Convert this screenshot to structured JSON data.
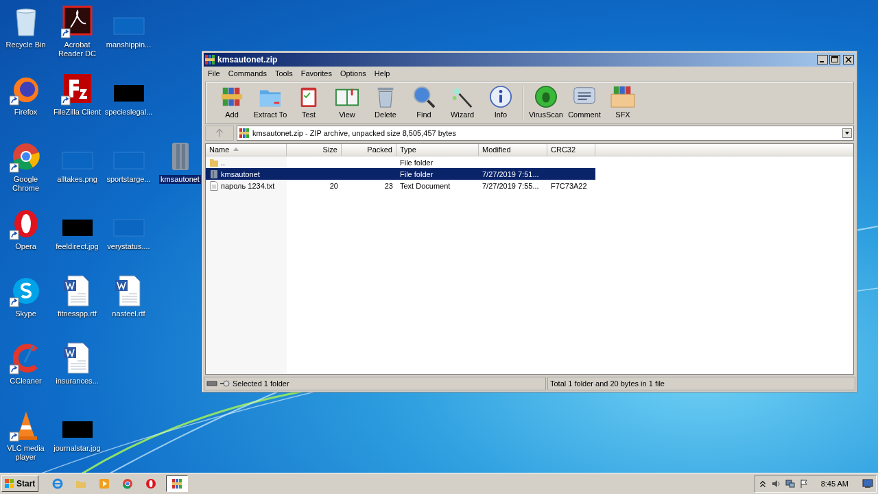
{
  "desktop": {
    "columns": [
      [
        {
          "label": "Recycle Bin",
          "kind": "recycle",
          "shortcut": false,
          "selected": false
        },
        {
          "label": "Firefox",
          "kind": "firefox",
          "shortcut": true,
          "selected": false
        },
        {
          "label": "Google Chrome",
          "kind": "chrome",
          "shortcut": true,
          "selected": false
        },
        {
          "label": "Opera",
          "kind": "opera",
          "shortcut": true,
          "selected": false
        },
        {
          "label": "Skype",
          "kind": "skype",
          "shortcut": true,
          "selected": false
        },
        {
          "label": "CCleaner",
          "kind": "ccleaner",
          "shortcut": true,
          "selected": false
        },
        {
          "label": "VLC media player",
          "kind": "vlc",
          "shortcut": true,
          "selected": false
        }
      ],
      [
        {
          "label": "Acrobat Reader DC",
          "kind": "acrobat",
          "shortcut": true,
          "selected": false
        },
        {
          "label": "FileZilla Client",
          "kind": "filezilla",
          "shortcut": true,
          "selected": false
        },
        {
          "label": "alltakes.png",
          "kind": "thumb-light",
          "shortcut": false,
          "selected": false
        },
        {
          "label": "feeldirect.jpg",
          "kind": "thumb-dark",
          "shortcut": false,
          "selected": false
        },
        {
          "label": "fitnesspp.rtf",
          "kind": "word",
          "shortcut": false,
          "selected": false
        },
        {
          "label": "insurances...",
          "kind": "word",
          "shortcut": false,
          "selected": false
        },
        {
          "label": "journalstar.jpg",
          "kind": "thumb-dark",
          "shortcut": false,
          "selected": false
        }
      ],
      [
        {
          "label": "manshippin...",
          "kind": "thumb-light",
          "shortcut": false,
          "selected": false
        },
        {
          "label": "specieslegal...",
          "kind": "thumb-dark",
          "shortcut": false,
          "selected": false
        },
        {
          "label": "sportstarge...",
          "kind": "thumb-light",
          "shortcut": false,
          "selected": false
        },
        {
          "label": "verystatus....",
          "kind": "thumb-light",
          "shortcut": false,
          "selected": false
        },
        {
          "label": "nasteel.rtf",
          "kind": "word",
          "shortcut": false,
          "selected": false
        }
      ]
    ],
    "column_4": [
      {
        "label": "kmsautonet",
        "selected": true
      }
    ]
  },
  "window": {
    "title": "kmsautonet.zip",
    "menu": [
      "File",
      "Commands",
      "Tools",
      "Favorites",
      "Options",
      "Help"
    ],
    "toolbar": [
      [
        {
          "label": "Add",
          "kind": "add"
        },
        {
          "label": "Extract To",
          "kind": "extract"
        },
        {
          "label": "Test",
          "kind": "test"
        },
        {
          "label": "View",
          "kind": "view"
        },
        {
          "label": "Delete",
          "kind": "delete"
        },
        {
          "label": "Find",
          "kind": "find"
        },
        {
          "label": "Wizard",
          "kind": "wizard"
        },
        {
          "label": "Info",
          "kind": "info"
        }
      ],
      [
        {
          "label": "VirusScan",
          "kind": "virus"
        },
        {
          "label": "Comment",
          "kind": "comment"
        },
        {
          "label": "SFX",
          "kind": "sfx"
        }
      ]
    ],
    "address": "kmsautonet.zip - ZIP archive, unpacked size 8,505,457 bytes",
    "table": {
      "columns": [
        "Name",
        "Size",
        "Packed",
        "Type",
        "Modified",
        "CRC32"
      ],
      "rows": [
        {
          "kind": "up",
          "selected": false,
          "cells": [
            "..",
            "",
            "",
            "File folder",
            "",
            ""
          ]
        },
        {
          "kind": "folder",
          "selected": true,
          "cells": [
            "kmsautonet",
            "",
            "",
            "File folder",
            "7/27/2019 7:51...",
            ""
          ]
        },
        {
          "kind": "file",
          "selected": false,
          "cells": [
            "пароль 1234.txt",
            "20",
            "23",
            "Text Document",
            "7/27/2019 7:55...",
            "F7C73A22"
          ]
        }
      ]
    },
    "status_bar": {
      "left": "Selected 1 folder",
      "right": "Total 1 folder and 20 bytes in 1 file"
    }
  },
  "taskbar": {
    "start": "Start",
    "apps": [
      {
        "kind": "ie",
        "selected": false
      },
      {
        "kind": "explorer",
        "selected": false
      },
      {
        "kind": "media",
        "selected": false
      },
      {
        "kind": "chrome",
        "selected": false
      },
      {
        "kind": "opera",
        "selected": false
      },
      {
        "kind": "winrar",
        "selected": true
      }
    ],
    "clock": "8:45 AM"
  }
}
